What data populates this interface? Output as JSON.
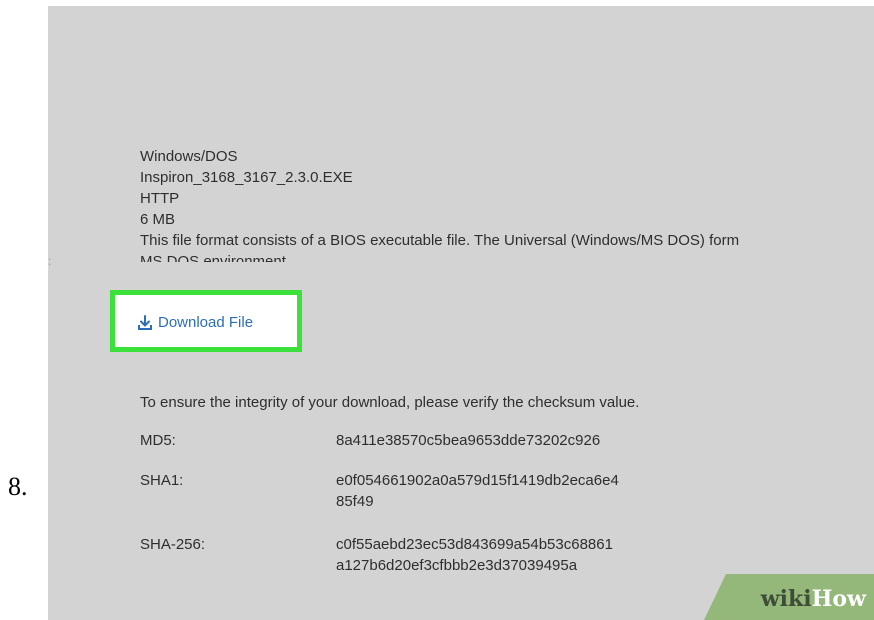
{
  "step_number": "8.",
  "file_info": {
    "platform": "Windows/DOS",
    "file_name": "Inspiron_3168_3167_2.3.0.EXE",
    "protocol": "HTTP",
    "size": "6 MB",
    "description_line1": "This file format consists of a BIOS executable file. The Universal (Windows/MS DOS) form",
    "description_line2": "MS DOS environment."
  },
  "download": {
    "label": "Download File",
    "icon": "download-icon",
    "highlight_color": "#3be03b",
    "link_color": "#2a6fb8"
  },
  "checksum": {
    "intro": "To ensure the integrity of your download, please verify the checksum value.",
    "md5_label": "MD5:",
    "md5_value": "8a411e38570c5bea9653dde73202c926",
    "sha1_label": "SHA1:",
    "sha1_value_line1": "e0f054661902a0a579d15f1419db2eca6e4",
    "sha1_value_line2": "85f49",
    "sha256_label": "SHA-256:",
    "sha256_value_line1": "c0f55aebd23ec53d843699a54b53c68861",
    "sha256_value_line2": "a127b6d20ef3cfbbb2e3d37039495a"
  },
  "watermark": {
    "part1": "wiki",
    "part2": "How",
    "color": "#93b87a"
  }
}
